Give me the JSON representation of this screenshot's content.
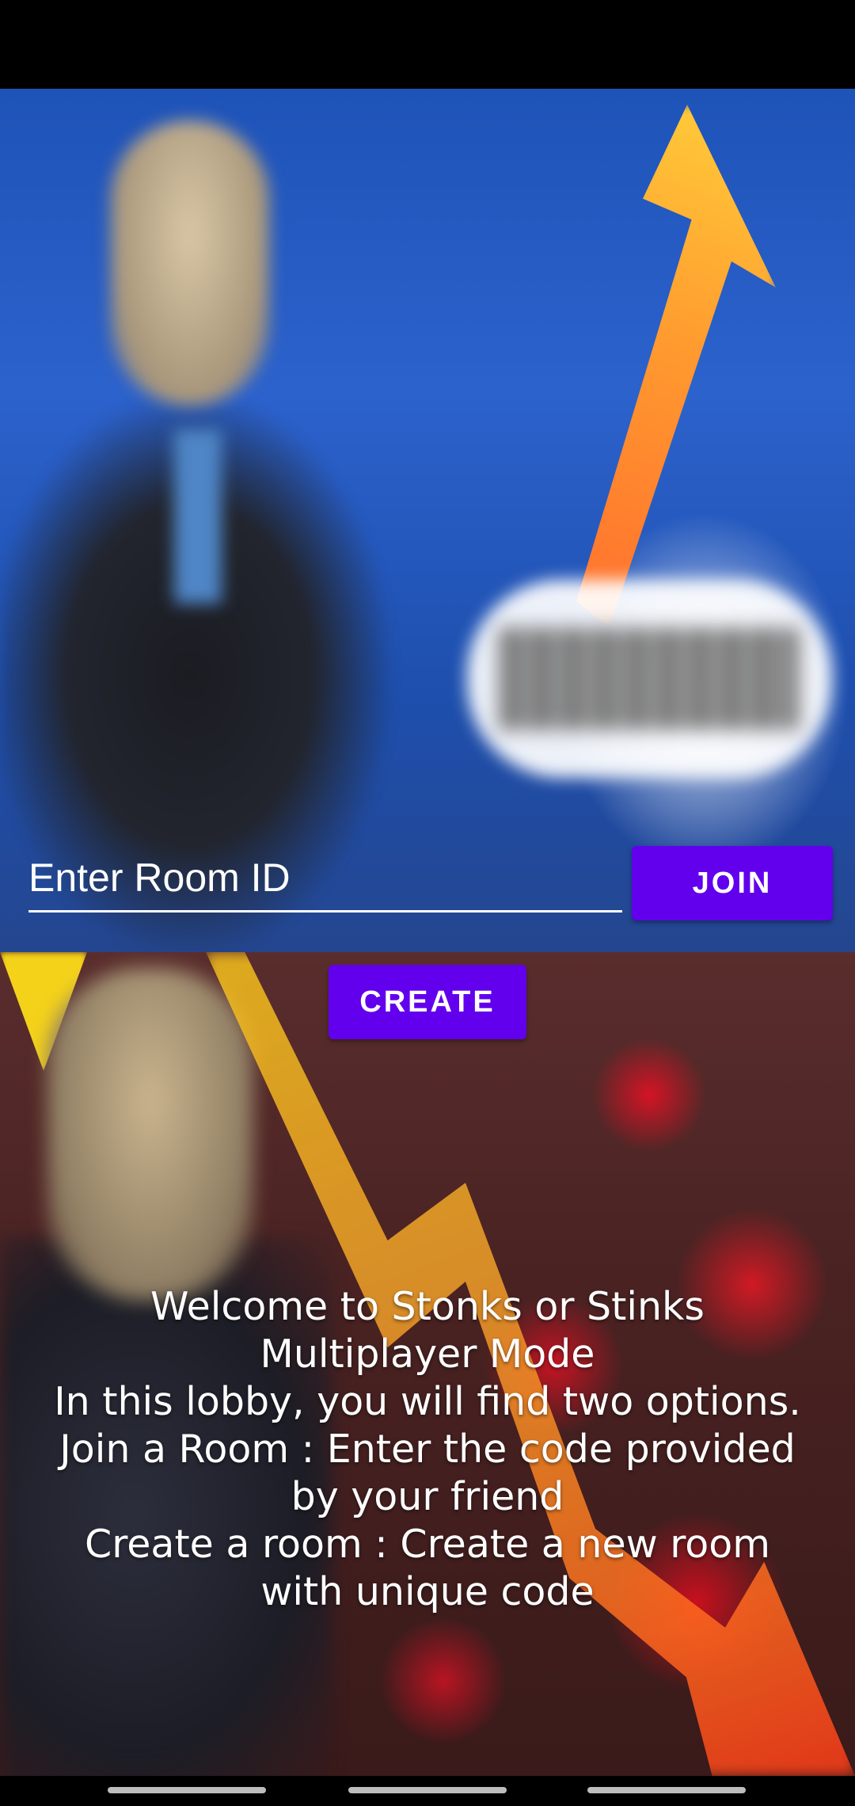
{
  "room": {
    "input_placeholder": "Enter Room ID",
    "input_value": ""
  },
  "buttons": {
    "join_label": "JOIN",
    "create_label": "CREATE"
  },
  "welcome": {
    "lines": [
      "Welcome to Stonks or Stinks",
      "Multiplayer Mode",
      "In this lobby, you will find two options.",
      "Join a Room : Enter the code provided",
      "by your friend",
      "Create a room : Create a new room",
      "with unique code"
    ]
  },
  "colors": {
    "button_bg": "#6200ee",
    "button_text": "#ffffff",
    "text": "#ffffff",
    "system_bars": "#000000"
  },
  "icons": {
    "background_top": "stonks-meme-image",
    "background_bottom": "stinks-meme-image"
  }
}
